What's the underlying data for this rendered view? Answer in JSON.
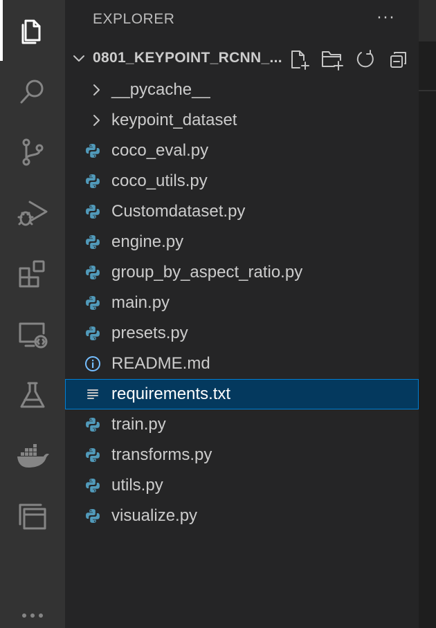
{
  "activity_bar": {
    "items": [
      {
        "name": "explorer",
        "icon": "files-icon",
        "active": true
      },
      {
        "name": "search",
        "icon": "search-icon"
      },
      {
        "name": "source-control",
        "icon": "source-control-icon"
      },
      {
        "name": "run-debug",
        "icon": "run-debug-icon"
      },
      {
        "name": "extensions",
        "icon": "extensions-icon"
      },
      {
        "name": "remote-explorer",
        "icon": "remote-explorer-icon"
      },
      {
        "name": "testing",
        "icon": "flask-icon"
      },
      {
        "name": "docker",
        "icon": "docker-icon"
      },
      {
        "name": "windows",
        "icon": "windows-icon"
      },
      {
        "name": "more",
        "icon": "more-icon"
      }
    ]
  },
  "sidebar": {
    "title": "EXPLORER",
    "more_label": "···",
    "folder": {
      "name": "0801_KEYPOINT_RCNN_...",
      "expanded": true
    },
    "items": [
      {
        "label": "__pycache__",
        "type": "folder"
      },
      {
        "label": "keypoint_dataset",
        "type": "folder"
      },
      {
        "label": "coco_eval.py",
        "type": "python"
      },
      {
        "label": "coco_utils.py",
        "type": "python"
      },
      {
        "label": "Customdataset.py",
        "type": "python"
      },
      {
        "label": "engine.py",
        "type": "python"
      },
      {
        "label": "group_by_aspect_ratio.py",
        "type": "python"
      },
      {
        "label": "main.py",
        "type": "python"
      },
      {
        "label": "presets.py",
        "type": "python"
      },
      {
        "label": "README.md",
        "type": "info"
      },
      {
        "label": "requirements.txt",
        "type": "text",
        "selected": true
      },
      {
        "label": "train.py",
        "type": "python"
      },
      {
        "label": "transforms.py",
        "type": "python"
      },
      {
        "label": "utils.py",
        "type": "python"
      },
      {
        "label": "visualize.py",
        "type": "python"
      }
    ]
  },
  "colors": {
    "activity_bg": "#333333",
    "sidebar_bg": "#252526",
    "selected_bg": "#04395e",
    "selected_border": "#007fd4",
    "python_blue": "#519aba",
    "info_blue": "#75beff"
  }
}
